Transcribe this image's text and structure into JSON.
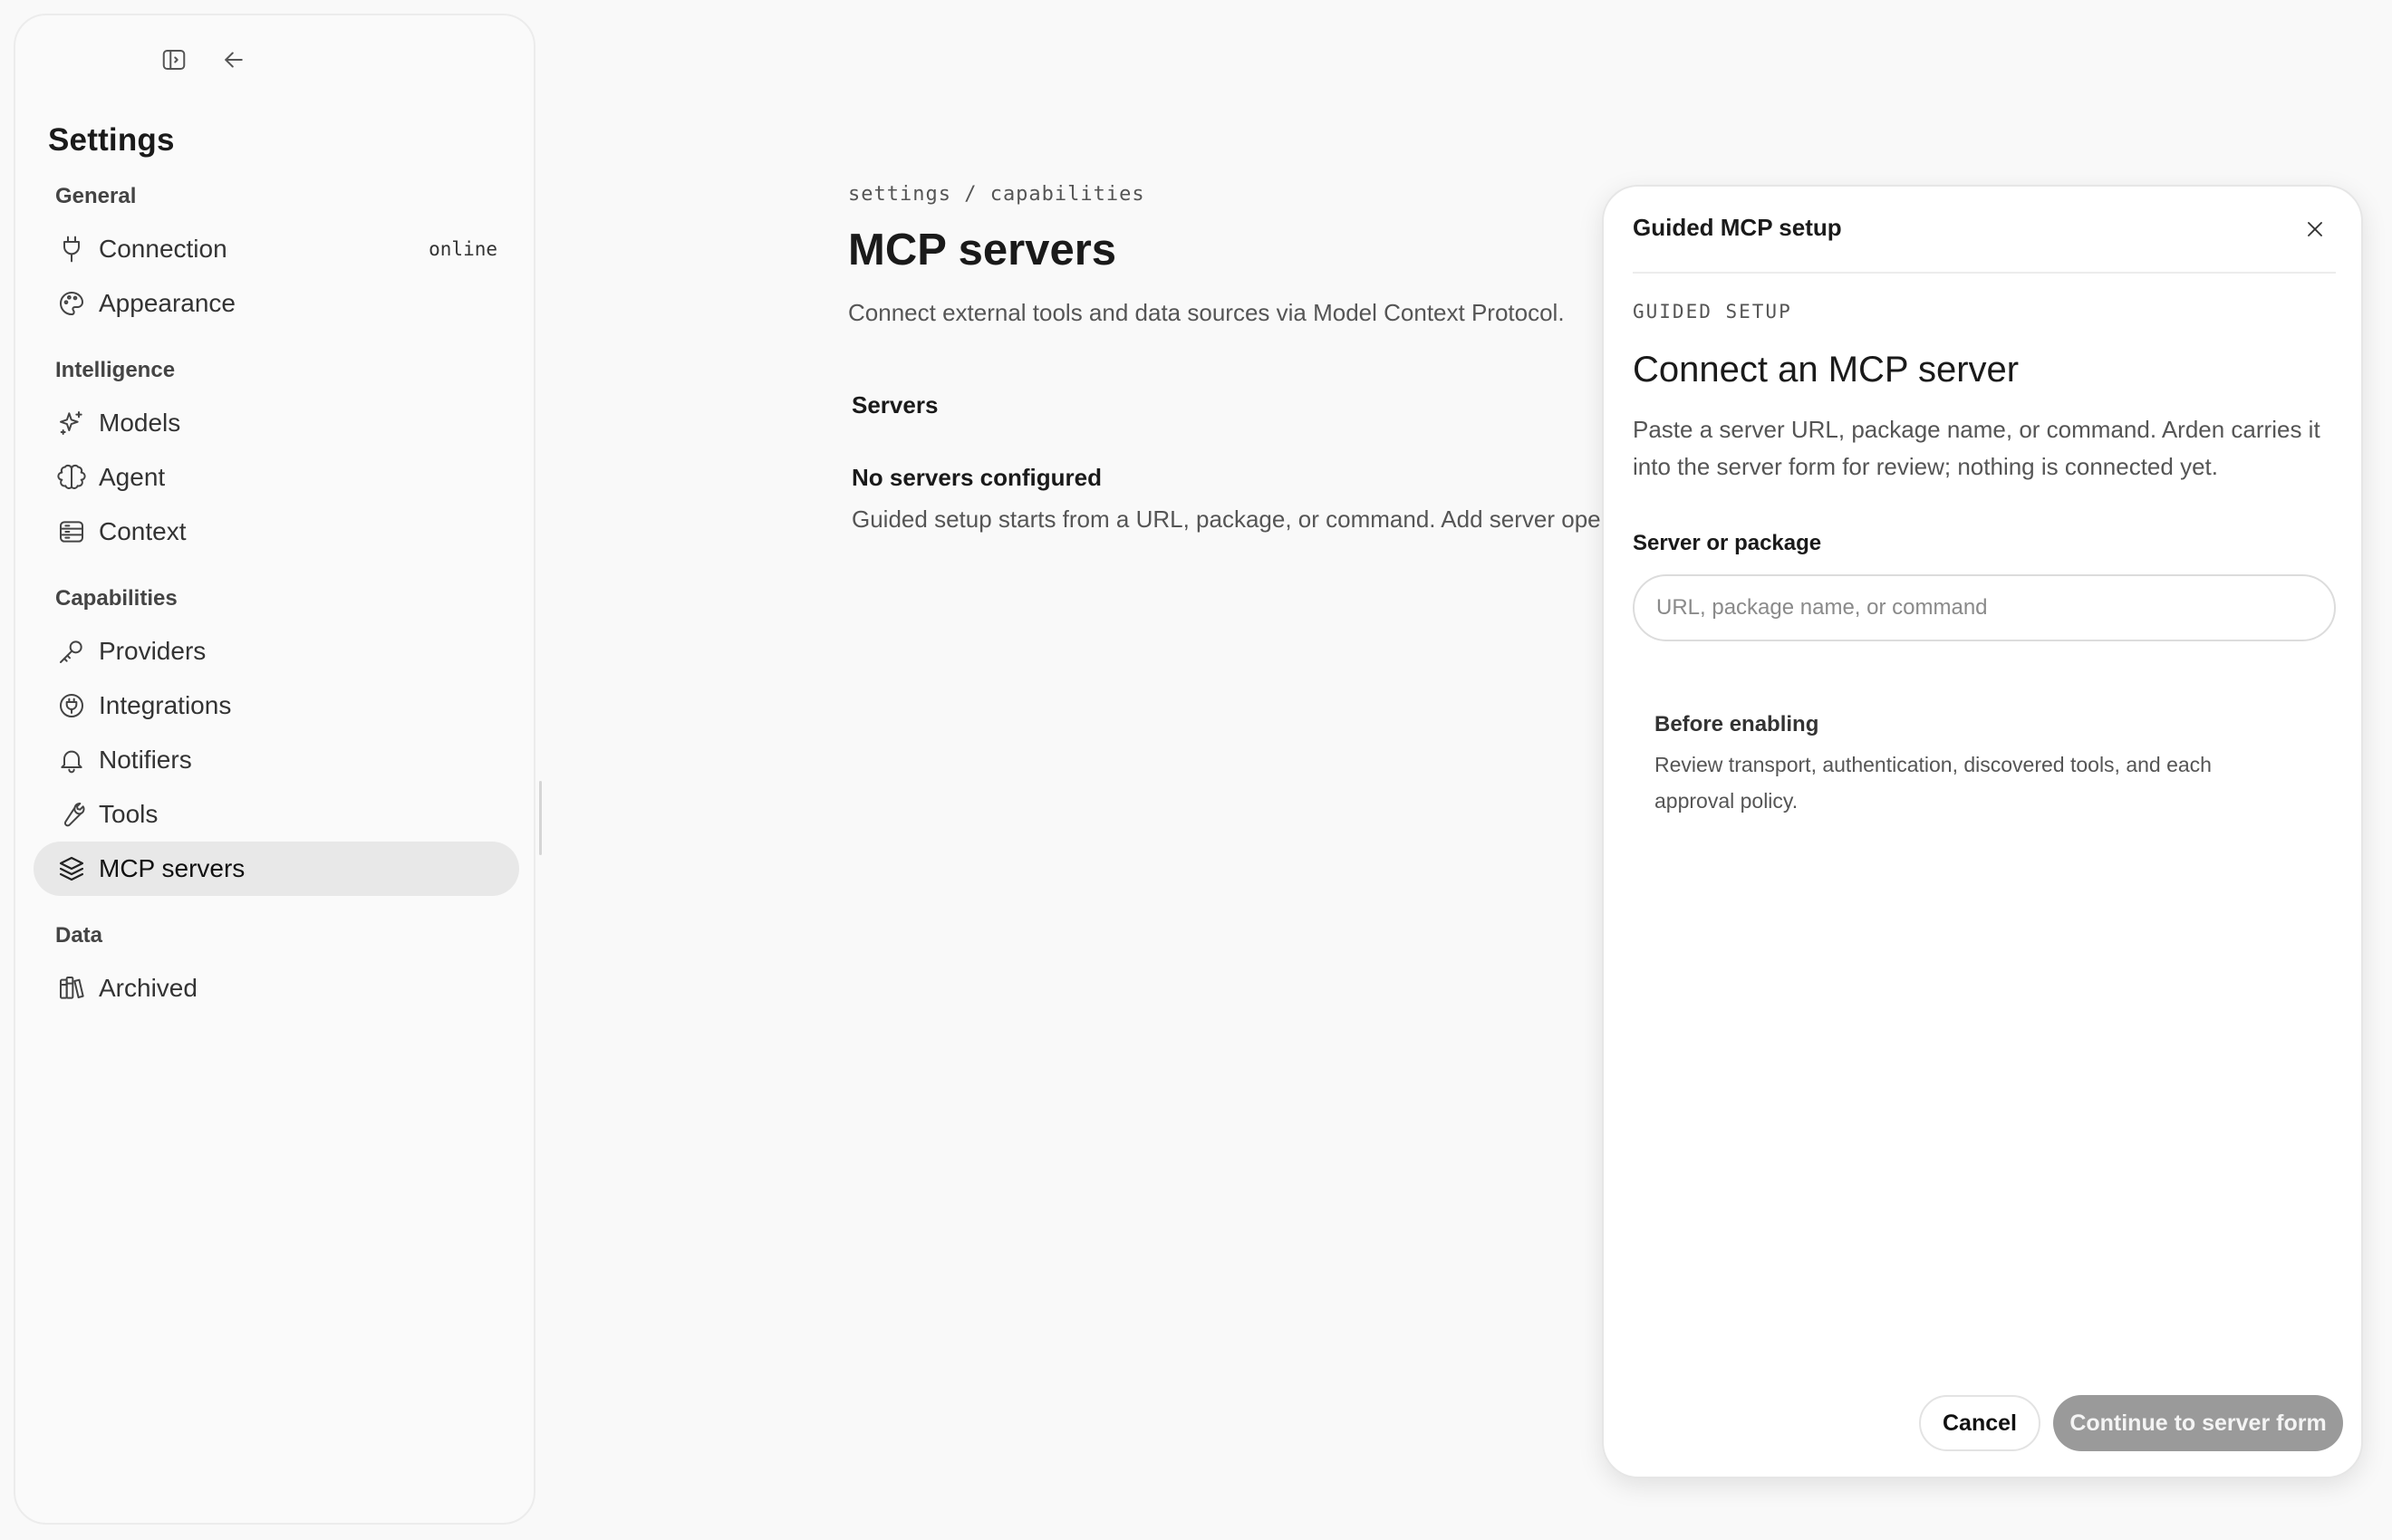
{
  "sidebar": {
    "title": "Settings",
    "top_icons": [
      "panel-toggle-icon",
      "arrow-left-icon"
    ],
    "sections": {
      "general": "General",
      "intelligence": "Intelligence",
      "capabilities": "Capabilities",
      "data": "Data"
    },
    "items": {
      "connection": {
        "label": "Connection",
        "badge": "online",
        "icon": "plug-icon"
      },
      "appearance": {
        "label": "Appearance",
        "icon": "palette-icon"
      },
      "models": {
        "label": "Models",
        "icon": "sparkle-icon"
      },
      "agent": {
        "label": "Agent",
        "icon": "brain-icon"
      },
      "context": {
        "label": "Context",
        "icon": "stack-list-icon"
      },
      "providers": {
        "label": "Providers",
        "icon": "key-icon"
      },
      "integrations": {
        "label": "Integrations",
        "icon": "plug-circle-icon"
      },
      "notifiers": {
        "label": "Notifiers",
        "icon": "bell-icon"
      },
      "tools": {
        "label": "Tools",
        "icon": "wrench-icon"
      },
      "mcp_servers": {
        "label": "MCP servers",
        "icon": "layers-icon",
        "active": true
      },
      "archived": {
        "label": "Archived",
        "icon": "library-icon"
      }
    }
  },
  "main": {
    "breadcrumb": "settings / capabilities",
    "title": "MCP servers",
    "description": "Connect external tools and data sources via Model Context Protocol.",
    "servers_heading": "Servers",
    "empty_title": "No servers configured",
    "empty_text": "Guided setup starts from a URL, package, or command. Add server opens"
  },
  "dialog": {
    "title": "Guided MCP setup",
    "eyebrow": "GUIDED SETUP",
    "heading": "Connect an MCP server",
    "description": "Paste a server URL, package name, or command. Arden carries it into the server form for review; nothing is connected yet.",
    "field_label": "Server or package",
    "field_value": "",
    "field_placeholder": "URL, package name, or command",
    "note_title": "Before enabling",
    "note_text": "Review transport, authentication, discovered tools, and each approval policy.",
    "cancel_label": "Cancel",
    "continue_label": "Continue to server form"
  }
}
